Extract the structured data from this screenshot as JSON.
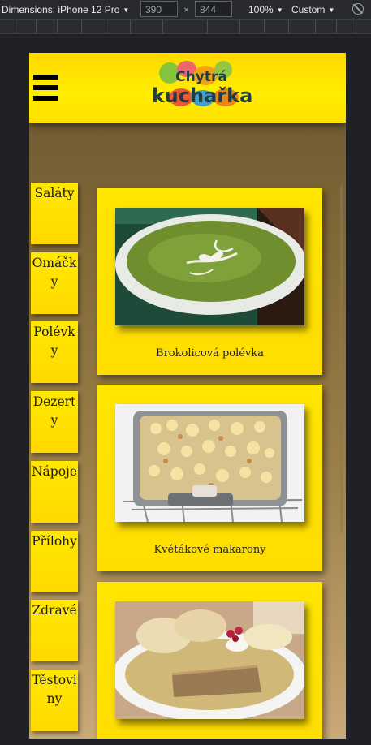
{
  "devtools": {
    "dimensions_label": "Dimensions: iPhone 12 Pro",
    "width": "390",
    "height": "844",
    "times": "×",
    "zoom": "100%",
    "throttle": "Custom"
  },
  "header": {
    "logo_line1": "Chytrá",
    "logo_line2": "kuchařka",
    "menu_icon": "hamburger-icon"
  },
  "categories": [
    "Saláty",
    "Omáčky",
    "Polévky",
    "Dezerty",
    "Nápoje",
    "Přílohy",
    "Zdravé",
    "Těstoviny"
  ],
  "recipes": [
    {
      "title": "Brokolicová polévka",
      "image": "broccoli-soup-photo"
    },
    {
      "title": "Květákové makarony",
      "image": "cauliflower-macaroni-photo"
    },
    {
      "title": "",
      "image": "dumplings-sauce-photo"
    }
  ],
  "colors": {
    "header_yellow": "#ffe600",
    "logo_text": "#1f3d45",
    "background_brown": "#7e6636"
  }
}
